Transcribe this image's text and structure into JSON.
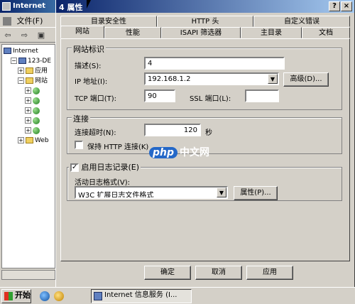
{
  "mmc": {
    "title": "Internet",
    "menu_file": "文件(F)",
    "toolbar": {
      "back": "⇦",
      "forward": "⇨",
      "up": "▣"
    },
    "tree": [
      {
        "label": "Internet",
        "indent": 0,
        "icon": "pc"
      },
      {
        "label": "123-DE",
        "indent": 1,
        "icon": "pc",
        "toggle": "−"
      },
      {
        "label": "应用",
        "indent": 2,
        "icon": "folder",
        "toggle": "+"
      },
      {
        "label": "网站",
        "indent": 2,
        "icon": "folder",
        "toggle": "−"
      },
      {
        "label": "",
        "indent": 3,
        "icon": "globe",
        "toggle": "+"
      },
      {
        "label": "",
        "indent": 3,
        "icon": "globe",
        "toggle": "+"
      },
      {
        "label": "",
        "indent": 3,
        "icon": "globe",
        "toggle": "+"
      },
      {
        "label": "",
        "indent": 3,
        "icon": "globe",
        "toggle": "+"
      },
      {
        "label": "",
        "indent": 3,
        "icon": "globe",
        "toggle": "+"
      },
      {
        "label": "Web",
        "indent": 2,
        "icon": "folder",
        "toggle": "+"
      }
    ]
  },
  "dialog": {
    "title": "4 属性",
    "help": "?",
    "close": "×",
    "tabs_row1": [
      "目录安全性",
      "HTTP 头",
      "自定义错误"
    ],
    "tabs_row2": [
      "网站",
      "性能",
      "ISAPI 筛选器",
      "主目录",
      "文档"
    ],
    "site_id": {
      "group": "网站标识",
      "desc_label": "描述(S):",
      "desc_value": "4",
      "ip_label": "IP 地址(I):",
      "ip_value": "192.168.1.2",
      "advanced_button": "高级(D)...",
      "tcp_label": "TCP 端口(T):",
      "tcp_value": "90",
      "ssl_label": "SSL 端口(L):",
      "ssl_value": ""
    },
    "connection": {
      "group": "连接",
      "timeout_label": "连接超时(N):",
      "timeout_value": "120",
      "timeout_unit": "秒",
      "keepalive_label": "保持 HTTP 连接(K)",
      "keepalive_checked": false
    },
    "logging": {
      "enable_label": "启用日志记录(E)",
      "enable_checked": true,
      "format_label": "活动日志格式(V):",
      "format_value": "W3C 扩展日志文件格式",
      "properties_button": "属性(P)..."
    },
    "ok_button": "确定",
    "cancel_button": "取消",
    "apply_button": "应用"
  },
  "watermark": {
    "badge": "php",
    "text": "中文网"
  },
  "taskbar": {
    "start": "开始",
    "task": "Internet 信息服务 (I..."
  }
}
